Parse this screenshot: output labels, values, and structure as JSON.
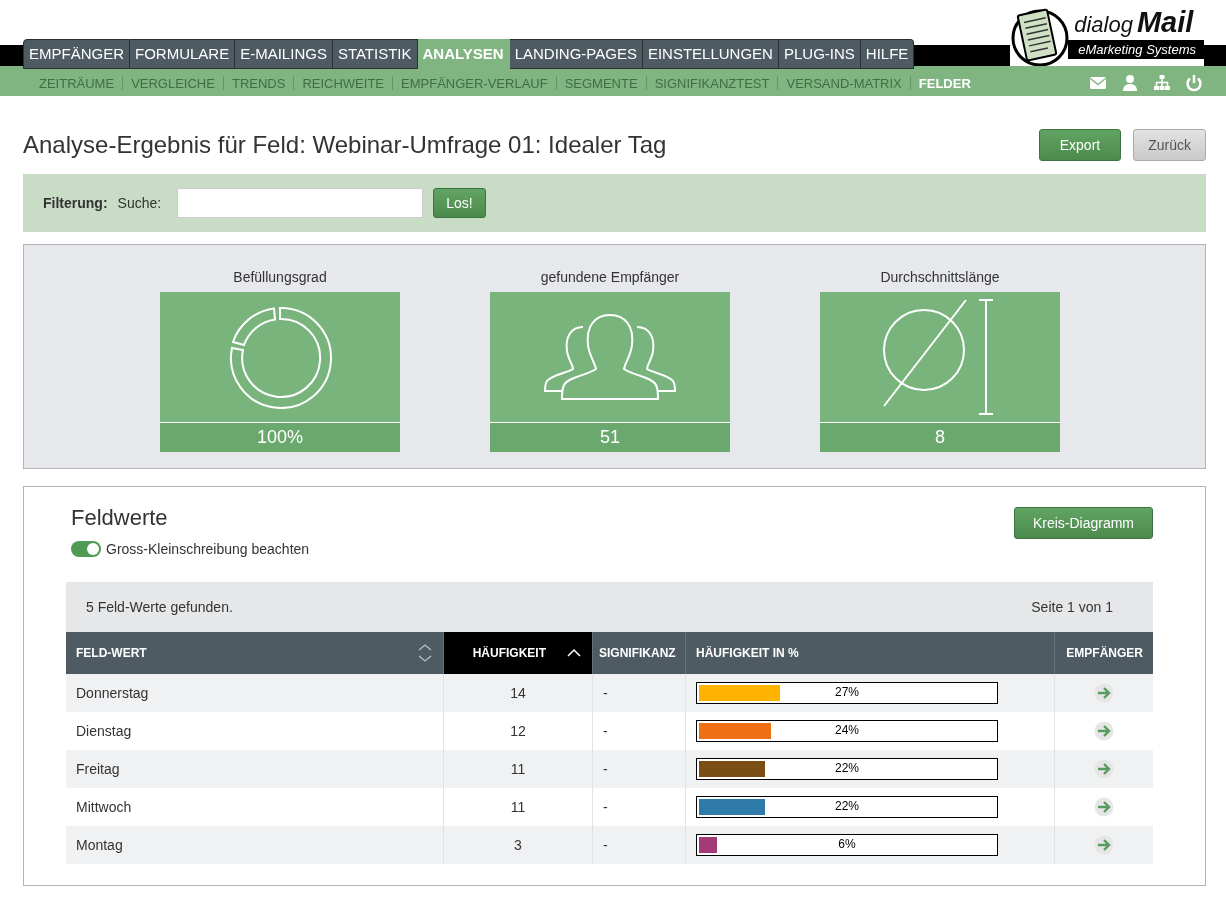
{
  "logo": {
    "word_1": "dialog",
    "word_2": "Mail",
    "tagline": "eMarketing Systems"
  },
  "main_tabs": [
    {
      "label": "EMPFÄNGER",
      "selected": false
    },
    {
      "label": "FORMULARE",
      "selected": false
    },
    {
      "label": "E-MAILINGS",
      "selected": false
    },
    {
      "label": "STATISTIK",
      "selected": false
    },
    {
      "label": "ANALYSEN",
      "selected": true
    },
    {
      "label": "LANDING-PAGES",
      "selected": false
    },
    {
      "label": "EINSTELLUNGEN",
      "selected": false
    },
    {
      "label": "PLUG-INS",
      "selected": false
    },
    {
      "label": "HILFE",
      "selected": false
    }
  ],
  "sub_tabs": [
    {
      "label": "ZEITRÄUME",
      "selected": false
    },
    {
      "label": "VERGLEICHE",
      "selected": false
    },
    {
      "label": "TRENDS",
      "selected": false
    },
    {
      "label": "REICHWEITE",
      "selected": false
    },
    {
      "label": "EMPFÄNGER-VERLAUF",
      "selected": false
    },
    {
      "label": "SEGMENTE",
      "selected": false
    },
    {
      "label": "SIGNIFIKANZTEST",
      "selected": false
    },
    {
      "label": "VERSAND-MATRIX",
      "selected": false
    },
    {
      "label": "FELDER",
      "selected": true
    }
  ],
  "header_icons": [
    {
      "kind": "mail"
    },
    {
      "kind": "user"
    },
    {
      "kind": "sitemap"
    },
    {
      "kind": "power"
    }
  ],
  "page_title": "Analyse-Ergebnis für Feld: Webinar-Umfrage 01: Idealer Tag",
  "title_buttons": [
    {
      "label": "Export",
      "kind": "primary"
    },
    {
      "label": "Zurück",
      "kind": "secondary"
    }
  ],
  "filter": {
    "label": "Filterung:",
    "search_label": "Suche:",
    "button": "Los!"
  },
  "stats": [
    {
      "title": "Befüllungsgrad",
      "kind": "donut",
      "value": "100%"
    },
    {
      "title": "gefundene Empfänger",
      "kind": "people",
      "value": "51"
    },
    {
      "title": "Durchschnittslänge",
      "kind": "diameter",
      "value": "8"
    }
  ],
  "field_values": {
    "title": "Feldwerte",
    "chart_button": "Kreis-Diagramm",
    "toggle": {
      "label": "Gross-Kleinschreibung beachten",
      "on": true
    },
    "summary": "5 Feld-Werte gefunden.",
    "pagination": "Seite 1 von 1",
    "table": {
      "columns": [
        {
          "label": "FELD-WERT",
          "sortable": true,
          "sorted": false
        },
        {
          "label": "HÄUFIGKEIT",
          "sortable": true,
          "sorted": true
        },
        {
          "label": "SIGNIFIKANZ",
          "sortable": false,
          "sorted": false
        },
        {
          "label": "HÄUFIGKEIT IN %",
          "sortable": false,
          "sorted": false
        },
        {
          "label": "EMPFÄNGER",
          "sortable": false,
          "sorted": false
        }
      ],
      "rows": [
        {
          "value": "Donnerstag",
          "count": "14",
          "significance": "-",
          "percent": "27%",
          "level": 0.27,
          "color": "#ffb300"
        },
        {
          "value": "Dienstag",
          "count": "12",
          "significance": "-",
          "percent": "24%",
          "level": 0.24,
          "color": "#ef7014"
        },
        {
          "value": "Freitag",
          "count": "11",
          "significance": "-",
          "percent": "22%",
          "level": 0.22,
          "color": "#7b4e15"
        },
        {
          "value": "Mittwoch",
          "count": "11",
          "significance": "-",
          "percent": "22%",
          "level": 0.22,
          "color": "#2e7aa8"
        },
        {
          "value": "Montag",
          "count": "3",
          "significance": "-",
          "percent": "6%",
          "level": 0.06,
          "color": "#a23a78"
        }
      ]
    }
  }
}
